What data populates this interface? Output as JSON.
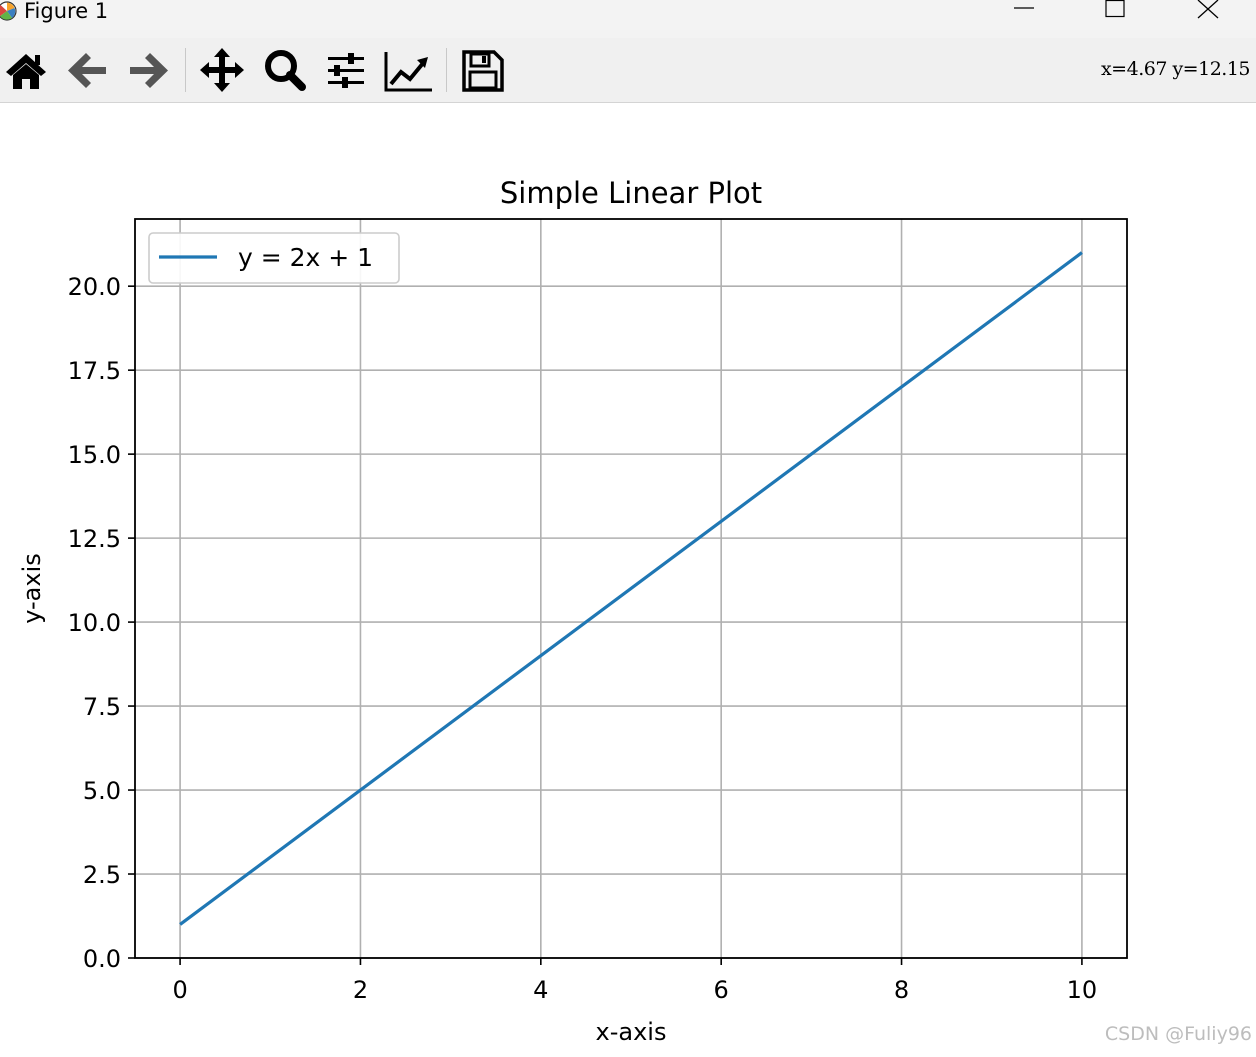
{
  "window": {
    "title": "Figure 1",
    "icon": "matplotlib-logo-icon",
    "controls": [
      "minimize-icon",
      "maximize-icon",
      "close-icon"
    ]
  },
  "toolbar": {
    "tools": [
      {
        "name": "home",
        "icon": "home-icon"
      },
      {
        "name": "back",
        "icon": "arrow-left-icon"
      },
      {
        "name": "forward",
        "icon": "arrow-right-icon"
      },
      {
        "name": "pan",
        "icon": "move-icon"
      },
      {
        "name": "zoom",
        "icon": "magnifier-icon"
      },
      {
        "name": "configure-subplots",
        "icon": "sliders-icon"
      },
      {
        "name": "edit-axis",
        "icon": "line-chart-icon"
      },
      {
        "name": "save",
        "icon": "floppy-disk-icon"
      }
    ],
    "coords": "x=4.67  y=12.15"
  },
  "watermark": "CSDN @Fuliy96",
  "chart_data": {
    "type": "line",
    "title": "Simple Linear Plot",
    "xlabel": "x-axis",
    "ylabel": "y-axis",
    "xlim": [
      -0.5,
      10.5
    ],
    "ylim": [
      0,
      22
    ],
    "xticks": [
      0,
      2,
      4,
      6,
      8,
      10
    ],
    "yticks": [
      0,
      2.5,
      5,
      7.5,
      10,
      12.5,
      15,
      17.5,
      20
    ],
    "xtick_labels": [
      "0",
      "2",
      "4",
      "6",
      "8",
      "10"
    ],
    "ytick_labels": [
      "0.0",
      "2.5",
      "5.0",
      "7.5",
      "10.0",
      "12.5",
      "15.0",
      "17.5",
      "20.0"
    ],
    "grid": true,
    "legend": "top-left",
    "series": [
      {
        "name": "y = 2x + 1",
        "color": "#1f77b4",
        "x": [
          0,
          10
        ],
        "y": [
          1,
          21
        ]
      }
    ]
  }
}
